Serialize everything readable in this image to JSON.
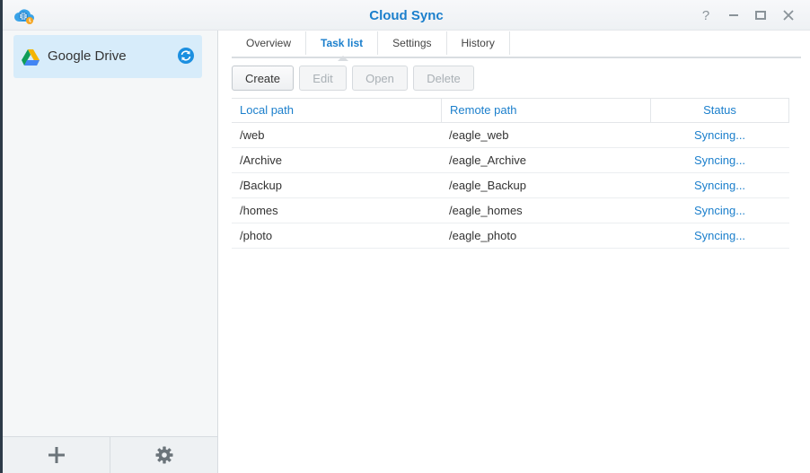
{
  "window": {
    "title": "Cloud Sync",
    "help_glyph": "?",
    "min_glyph": "—",
    "max_glyph": "▭",
    "close_glyph": "✕"
  },
  "sidebar": {
    "items": [
      {
        "label": "Google Drive",
        "icon": "google-drive-icon",
        "status_icon": "sync-icon"
      }
    ],
    "footer": {
      "add_glyph": "+",
      "settings_icon": "gear-icon"
    }
  },
  "tabs": [
    {
      "label": "Overview"
    },
    {
      "label": "Task list",
      "active": true
    },
    {
      "label": "Settings"
    },
    {
      "label": "History"
    }
  ],
  "toolbar": {
    "create": "Create",
    "edit": "Edit",
    "open": "Open",
    "delete": "Delete"
  },
  "table": {
    "columns": [
      "Local path",
      "Remote path",
      "Status"
    ],
    "rows": [
      {
        "local": "/web",
        "remote": "/eagle_web",
        "status": "Syncing..."
      },
      {
        "local": "/Archive",
        "remote": "/eagle_Archive",
        "status": "Syncing..."
      },
      {
        "local": "/Backup",
        "remote": "/eagle_Backup",
        "status": "Syncing..."
      },
      {
        "local": "/homes",
        "remote": "/eagle_homes",
        "status": "Syncing..."
      },
      {
        "local": "/photo",
        "remote": "/eagle_photo",
        "status": "Syncing..."
      }
    ]
  },
  "colors": {
    "accent": "#1b7fcc",
    "selected_bg": "#d7ecfa"
  }
}
